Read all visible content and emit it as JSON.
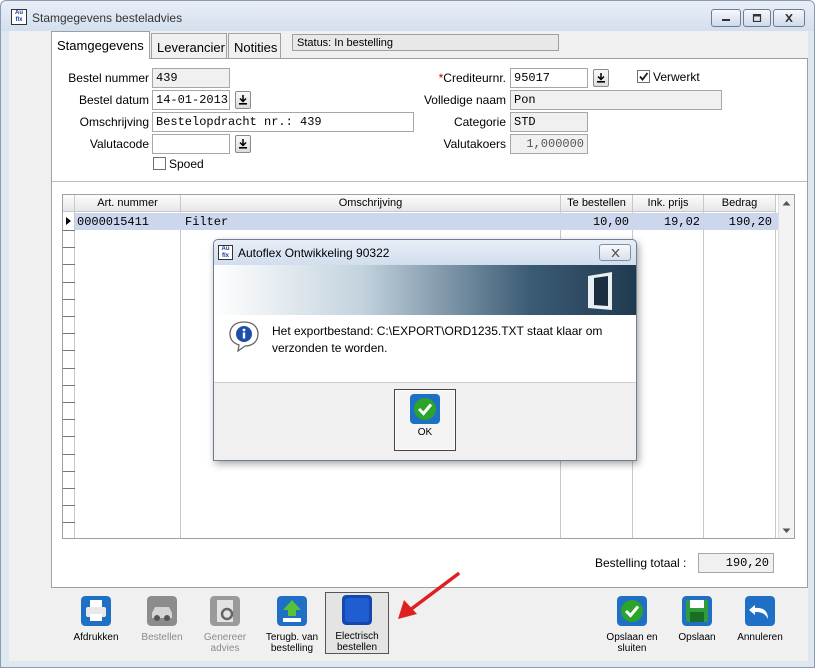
{
  "window": {
    "title": "Stamgegevens besteladvies",
    "app_icon_text": "Auto flex"
  },
  "tabs": [
    {
      "label": "Stamgegevens",
      "active": true
    },
    {
      "label": "Leverancier",
      "active": false
    },
    {
      "label": "Notities",
      "active": false
    }
  ],
  "status": "Status: In bestelling",
  "form": {
    "bestelnummer_label": "Bestel nummer",
    "bestelnummer": "439",
    "besteldatum_label": "Bestel datum",
    "besteldatum": "14-01-2013",
    "omschrijving_label": "Omschrijving",
    "omschrijving": "Bestelopdracht nr.: 439",
    "valutacode_label": "Valutacode",
    "valutacode": "",
    "spoed_label": "Spoed",
    "spoed_checked": false,
    "crediteurnr_required_mark": "*",
    "crediteurnr_label": "Crediteurnr.",
    "crediteurnr": "95017",
    "verwerkt_label": "Verwerkt",
    "verwerkt_checked": true,
    "volledige_naam_label": "Volledige naam",
    "volledige_naam": "Pon",
    "categorie_label": "Categorie",
    "categorie": "STD",
    "valutakoers_label": "Valutakoers",
    "valutakoers": "1,000000"
  },
  "grid": {
    "columns": [
      "Art. nummer",
      "Omschrijving",
      "Te bestellen",
      "Ink. prijs",
      "Bedrag"
    ],
    "rows": [
      {
        "art_nummer": "0000015411",
        "omschrijving": "Filter",
        "te_bestellen": "10,00",
        "ink_prijs": "19,02",
        "bedrag": "190,20"
      }
    ]
  },
  "totals": {
    "label": "Bestelling totaal :",
    "value": "190,20"
  },
  "toolbar": {
    "afdrukken": "Afdrukken",
    "bestellen": "Bestellen",
    "genereer_line1": "Genereer",
    "genereer_line2": "advies",
    "terugb_line1": "Terugb. van",
    "terugb_line2": "bestelling",
    "electrisch_line1": "Electrisch",
    "electrisch_line2": "bestellen",
    "opslaan_sluiten_line1": "Opslaan en",
    "opslaan_sluiten_line2": "sluiten",
    "opslaan": "Opslaan",
    "annuleren": "Annuleren"
  },
  "dialog": {
    "title": "Autoflex Ontwikkeling 90322",
    "message": "Het exportbestand: C:\\EXPORT\\ORD1235.TXT staat klaar om verzonden te worden.",
    "ok_label": "OK"
  },
  "colors": {
    "selected_row": "#ccd6ec",
    "annotation_arrow": "#e02020",
    "ok_green": "#2aa52a",
    "info_blue": "#1d4fa8"
  }
}
